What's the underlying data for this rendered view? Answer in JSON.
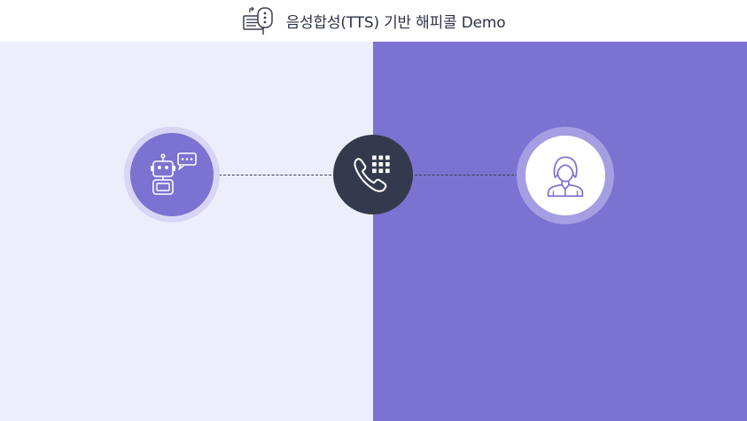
{
  "header": {
    "title": "음성합성(TTS) 기반 해피콜 Demo",
    "icon": "chat-document-icon"
  },
  "scene": {
    "bot_icon": "robot-chat-icon",
    "phone_icon": "phone-keypad-icon",
    "person_icon": "woman-user-icon"
  },
  "colors": {
    "left_bg": "#eceefc",
    "right_bg": "#7c72d1",
    "accent": "#7c72d1",
    "phone_bg": "#333a4d",
    "title_text": "#2d3148"
  }
}
